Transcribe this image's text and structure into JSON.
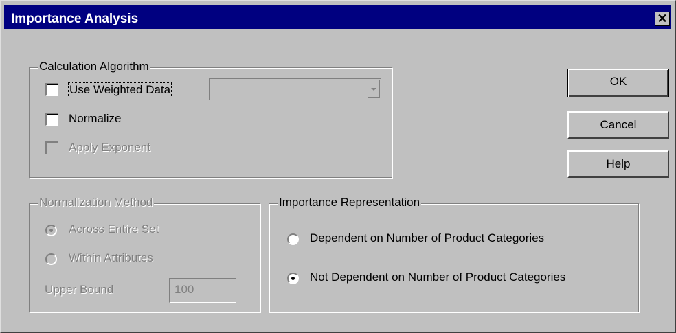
{
  "window": {
    "title": "Importance Analysis",
    "close_glyph": "✕"
  },
  "calc_group": {
    "legend": "Calculation Algorithm",
    "use_weighted": {
      "label": "Use Weighted Data",
      "checked": false
    },
    "weighted_select": {
      "value": ""
    },
    "normalize": {
      "label": "Normalize",
      "checked": false
    },
    "apply_exponent": {
      "label": "Apply Exponent",
      "checked": false,
      "enabled": false
    }
  },
  "buttons": {
    "ok": "OK",
    "cancel": "Cancel",
    "help": "Help"
  },
  "norm_group": {
    "legend": "Normalization Method",
    "across": {
      "label": "Across Entire Set",
      "selected": true
    },
    "within": {
      "label": "Within Attributes",
      "selected": false
    },
    "upper_bound": {
      "label": "Upper Bound",
      "value": "100"
    }
  },
  "imp_group": {
    "legend": "Importance Representation",
    "dependent": {
      "label": "Dependent on Number of Product Categories",
      "selected": false
    },
    "not_dependent": {
      "label": "Not Dependent on Number of Product Categories",
      "selected": true
    }
  },
  "icons": [
    "close-icon",
    "dropdown-arrow-icon"
  ]
}
